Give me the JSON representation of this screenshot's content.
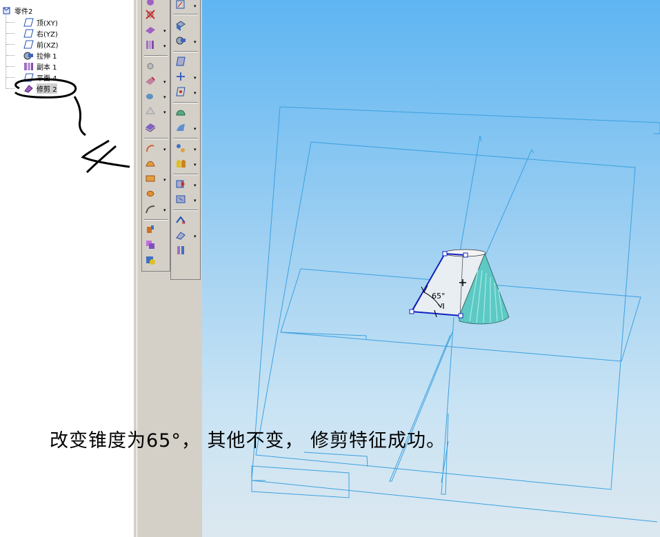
{
  "tree": {
    "root_label": "零件2",
    "items": [
      {
        "label": "顶(XY)",
        "icon": "plane-icon"
      },
      {
        "label": "右(YZ)",
        "icon": "plane-icon"
      },
      {
        "label": "前(XZ)",
        "icon": "plane-icon"
      },
      {
        "label": "拉伸 1",
        "icon": "extrude-icon"
      },
      {
        "label": "副本 1",
        "icon": "copy-icon"
      },
      {
        "label": "平面 4",
        "icon": "plane-icon"
      },
      {
        "label": "修剪 2",
        "icon": "trim-icon"
      }
    ]
  },
  "model": {
    "angle_label": "65°"
  },
  "caption": "改变锥度为65°，  其他不变，  修剪特征成功。",
  "colors": {
    "viewport_top": "#5eb5f2",
    "viewport_bottom": "#dce8f0",
    "plane_lines": "#3aa0e0",
    "sketch_blue": "#1020c0",
    "cone_teal": "#5cc9c4"
  }
}
